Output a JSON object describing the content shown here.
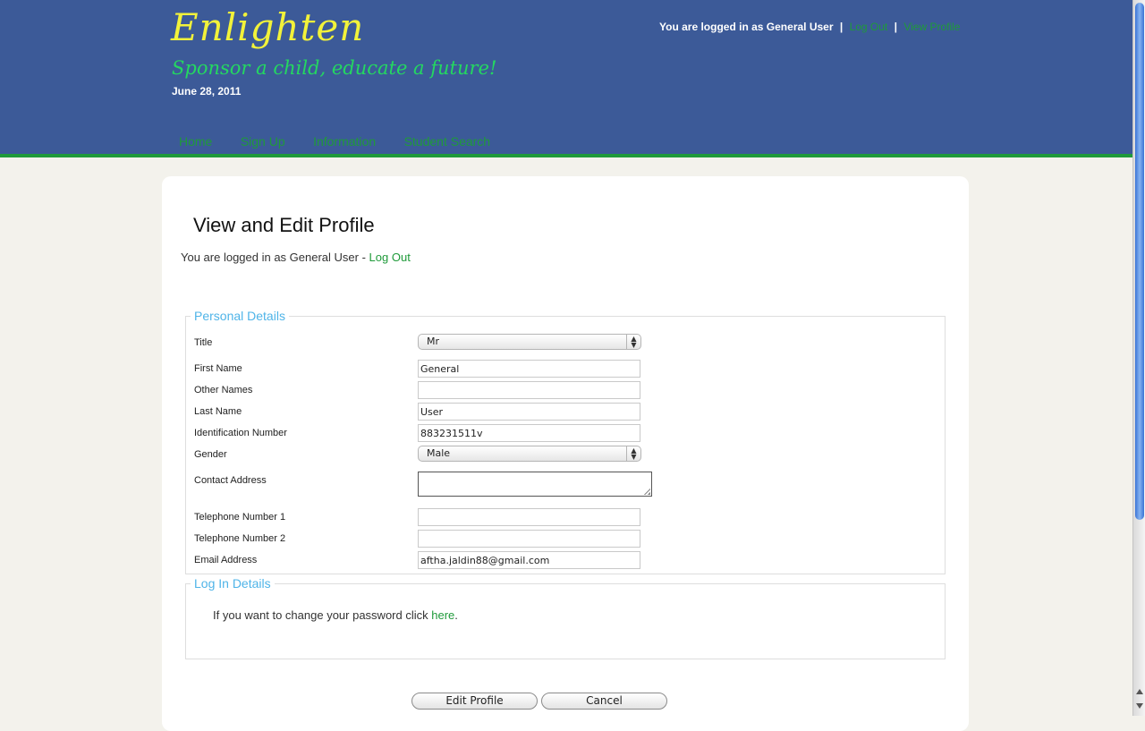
{
  "header": {
    "logo": "Enlighten",
    "tagline": "Sponsor a child, educate a future!",
    "date": "June 28, 2011",
    "status_text": "You are logged in as General User",
    "separator": "|",
    "logout_link": "Log Out",
    "view_profile_link": "View Profile"
  },
  "nav": {
    "items": [
      {
        "label": "Home"
      },
      {
        "label": "Sign Up"
      },
      {
        "label": "Information"
      },
      {
        "label": "Student Search"
      }
    ]
  },
  "main": {
    "title": "View and Edit Profile",
    "login_status": "You are logged in as General User - ",
    "logout_link": "Log Out"
  },
  "personal_details": {
    "legend": "Personal Details",
    "fields": {
      "title": {
        "label": "Title",
        "value": "Mr"
      },
      "first_name": {
        "label": "First Name",
        "value": "General"
      },
      "other_names": {
        "label": "Other Names",
        "value": ""
      },
      "last_name": {
        "label": "Last Name",
        "value": "User"
      },
      "id_number": {
        "label": "Identification Number",
        "value": "883231511v"
      },
      "gender": {
        "label": "Gender",
        "value": "Male"
      },
      "contact_address": {
        "label": "Contact Address",
        "value": ""
      },
      "telephone_1": {
        "label": "Telephone Number 1",
        "value": ""
      },
      "telephone_2": {
        "label": "Telephone Number 2",
        "value": ""
      },
      "email": {
        "label": "Email Address",
        "value": "aftha.jaldin88@gmail.com"
      }
    }
  },
  "login_details": {
    "legend": "Log In Details",
    "text": "If you want to change your password click ",
    "link": "here",
    "suffix": "."
  },
  "buttons": {
    "edit_profile": "Edit Profile",
    "cancel": "Cancel"
  },
  "colors": {
    "header_bg": "#3c5a98",
    "link_green": "#1f9a3a",
    "logo_yellow": "#f2f23a",
    "legend_blue": "#4fb4e8"
  }
}
